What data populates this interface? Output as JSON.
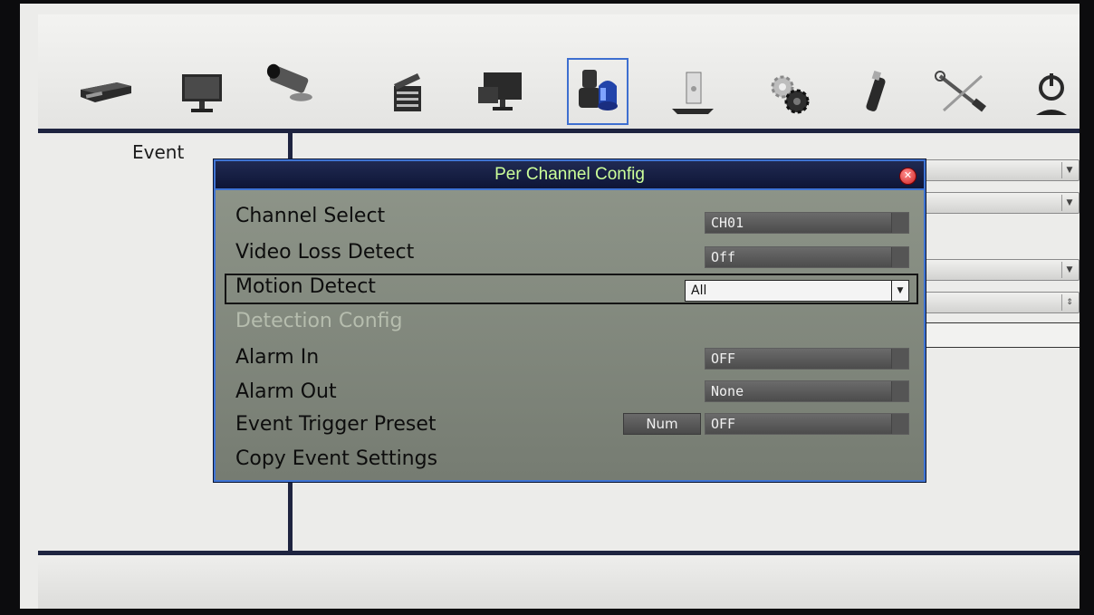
{
  "toolbar": {
    "icons": [
      {
        "name": "dvr-device-icon"
      },
      {
        "name": "monitor-icon"
      },
      {
        "name": "camera-icon"
      },
      {
        "name": "clapperboard-icon"
      },
      {
        "name": "display-network-icon"
      },
      {
        "name": "event-alarm-icon",
        "selected": true
      },
      {
        "name": "storage-disk-icon"
      },
      {
        "name": "gears-icon"
      },
      {
        "name": "usb-icon"
      },
      {
        "name": "tools-icon"
      },
      {
        "name": "power-icon"
      }
    ]
  },
  "sidebar": {
    "section_label": "Event"
  },
  "dialog": {
    "title": "Per Channel Config",
    "rows": {
      "channel_select": {
        "label": "Channel Select",
        "value": "CH01"
      },
      "video_loss": {
        "label": "Video Loss Detect",
        "value": "Off"
      },
      "motion_detect": {
        "label": "Motion Detect",
        "value": "All"
      },
      "detection_config": {
        "label": "Detection Config"
      },
      "alarm_in": {
        "label": "Alarm In",
        "value": "OFF"
      },
      "alarm_out": {
        "label": "Alarm Out",
        "value": "None"
      },
      "event_trigger_preset": {
        "label": "Event Trigger Preset",
        "button": "Num",
        "value": "OFF"
      },
      "copy_event_settings": {
        "label": "Copy Event Settings"
      }
    }
  },
  "colors": {
    "title_text": "#ccff99",
    "dialog_border": "#3f74d4",
    "frame_bar": "#1e2440"
  }
}
